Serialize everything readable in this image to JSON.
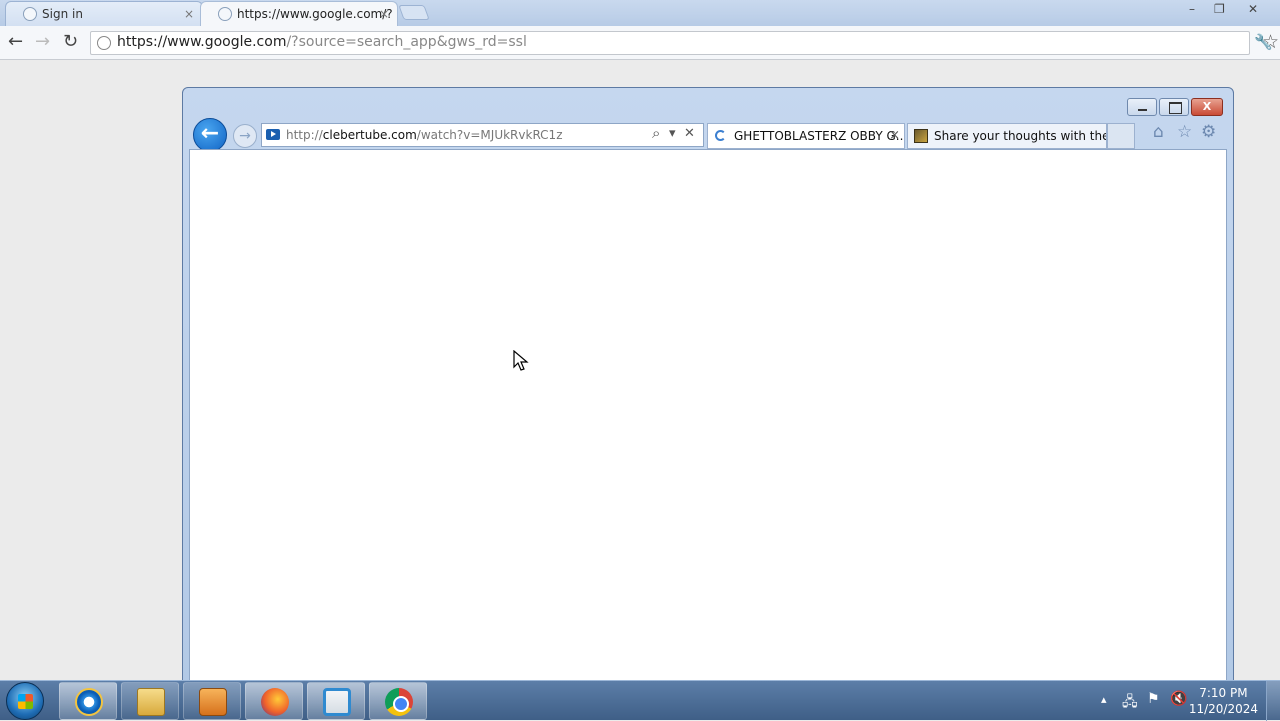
{
  "chrome": {
    "tabs": [
      {
        "title": "Sign in",
        "close": "×",
        "state": "inactive"
      },
      {
        "title": "https://www.google.com/?",
        "close": "×",
        "state": "active"
      }
    ],
    "window_controls": [
      "–",
      "❐",
      "✕"
    ],
    "toolbar": {
      "back_glyph": "←",
      "forward_glyph": "→",
      "reload_glyph": "↻",
      "url_host": "https://www.google.com",
      "url_rest": "/?source=search_app&gws_rd=ssl",
      "star_glyph": "☆",
      "wrench_glyph": "🔧"
    }
  },
  "ie": {
    "close_label": "X",
    "back_glyph": "←",
    "forward_glyph": "→",
    "address": {
      "scheme": "http://",
      "host": "clebertube.com",
      "path": "/watch?v=MJUkRvkRC1z",
      "search_glyph": "⌕",
      "dropdown_glyph": "▾",
      "stop_glyph": "✕"
    },
    "tabs": [
      {
        "title": "GHETTOBLASTERZ OBBY G...",
        "close": "×",
        "state": "active",
        "icon": "loading-spinner-icon"
      },
      {
        "title": "Share your thoughts with the ...",
        "state": "inactive",
        "icon": "site-favicon-icon"
      }
    ],
    "tools": {
      "home_glyph": "⌂",
      "favorites_glyph": "☆",
      "settings_glyph": "⚙"
    }
  },
  "taskbar": {
    "pinned": [
      "internet-explorer-icon",
      "folder-icon",
      "media-player-icon",
      "firefox-icon",
      "vmware-icon",
      "chrome-icon"
    ],
    "tray": {
      "up_arrow": "▴",
      "network_glyph": "🖧",
      "flag_glyph": "⚑",
      "volume_glyph": "🔇"
    },
    "clock": {
      "time": "7:10 PM",
      "date": "11/20/2024"
    }
  }
}
